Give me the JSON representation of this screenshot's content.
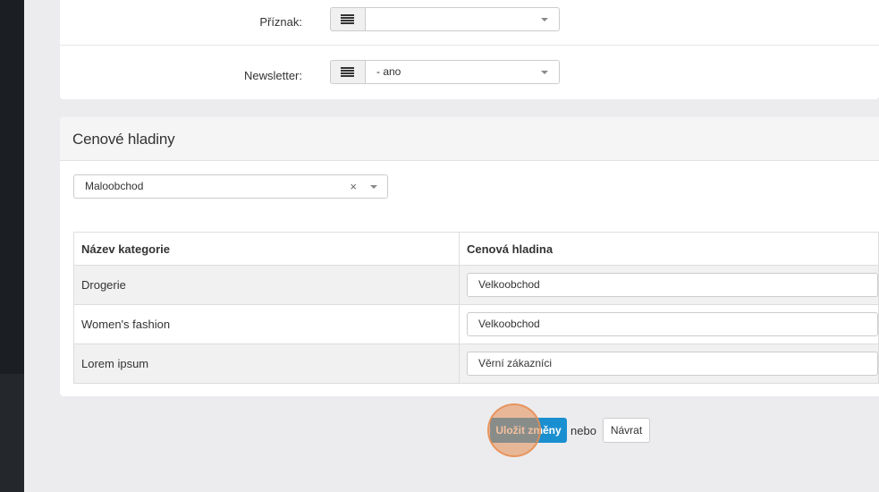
{
  "form": {
    "flag": {
      "label": "Příznak:",
      "value": ""
    },
    "newsletter": {
      "label": "Newsletter:",
      "value": "- ano"
    }
  },
  "prices": {
    "title": "Cenové hladiny",
    "selected_level": "Maloobchod",
    "clear_symbol": "×",
    "table": {
      "headers": [
        "Název kategorie",
        "Cenová hladina"
      ],
      "rows": [
        {
          "category": "Drogerie",
          "level": "Velkoobchod"
        },
        {
          "category": "Women's fashion",
          "level": "Velkoobchod"
        },
        {
          "category": "Lorem ipsum",
          "level": "Věrní zákazníci"
        }
      ]
    }
  },
  "actions": {
    "save_label": "Uložit změny",
    "or_label": "nebo",
    "back_label": "Návrat"
  },
  "colors": {
    "primary": "#1a8fd0",
    "click_highlight": "#e68c50",
    "sidebar": "#1b1f24"
  }
}
